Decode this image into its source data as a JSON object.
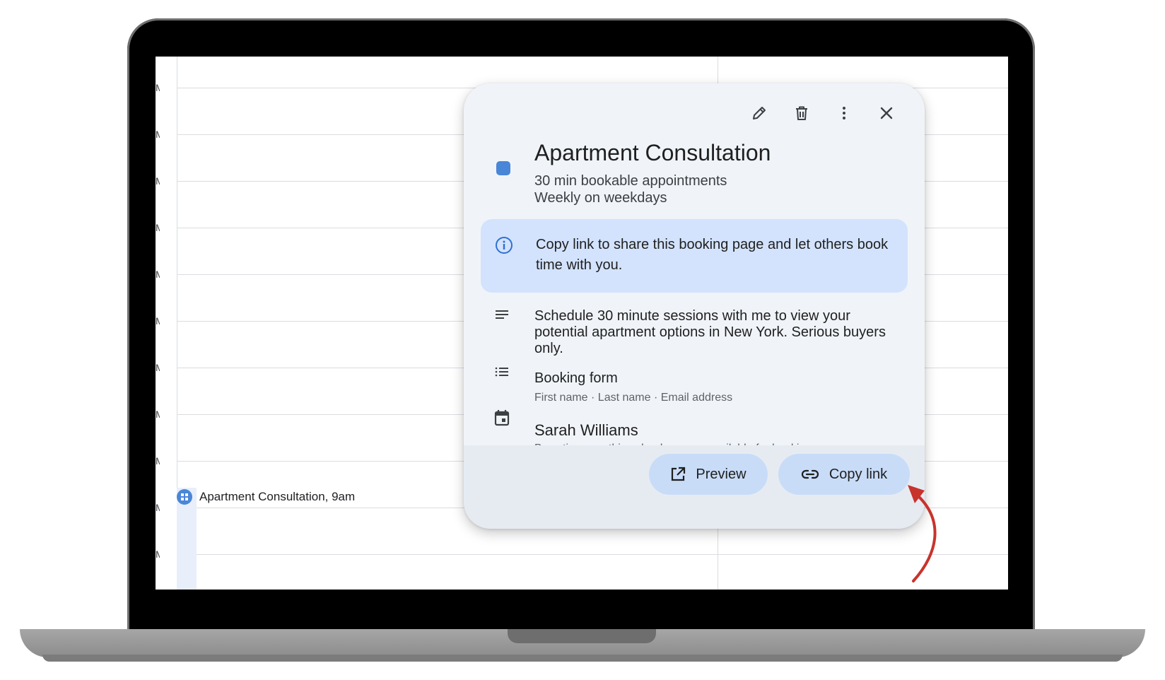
{
  "calendar": {
    "hour_tick_glyph": "M",
    "event_label": "Apartment Consultation, 9am"
  },
  "popup": {
    "toolbar": {
      "edit_icon": "pencil-icon",
      "delete_icon": "trash-icon",
      "more_icon": "more-vert-icon",
      "close_icon": "close-icon"
    },
    "color": "#4a86d8",
    "title": "Apartment Consultation",
    "duration": "30 min bookable appointments",
    "recurrence": "Weekly on weekdays",
    "info": "Copy link to share this booking page and let others book time with you.",
    "description": "Schedule 30 minute sessions with me to view your potential apartment options in New York. Serious buyers only.",
    "booking_form": {
      "title": "Booking form",
      "fields": "First name · Last name · Email address"
    },
    "calendar_owner": {
      "name": "Sarah Williams",
      "note": "Busy times on this calendar are unavailable for booking"
    },
    "buttons": {
      "preview": "Preview",
      "copy_link": "Copy link"
    }
  },
  "colors": {
    "card_bg": "#f0f4f9",
    "info_bg": "#d3e3fd",
    "button_bg": "#c8dcf8",
    "accent": "#4a86d8",
    "arrow": "#c8332c"
  }
}
